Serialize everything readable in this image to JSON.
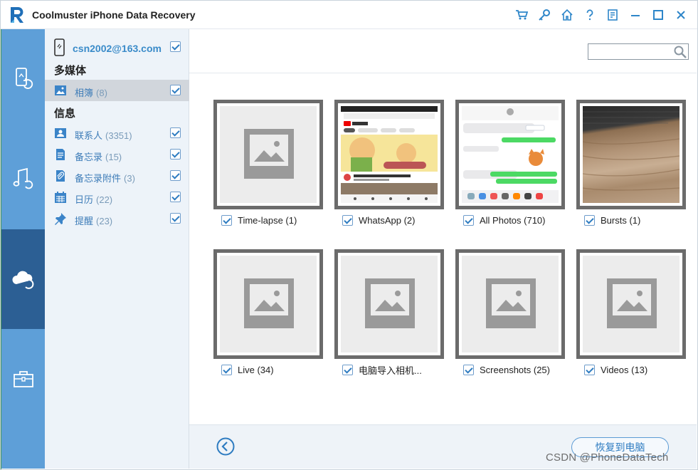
{
  "window": {
    "title": "Coolmuster iPhone Data Recovery",
    "toolbar_icons": [
      "cart-icon",
      "key-icon",
      "home-icon",
      "help-icon",
      "feedback-icon",
      "minimize-icon",
      "maximize-icon",
      "close-icon"
    ]
  },
  "rail": {
    "items": [
      {
        "name": "recover-from-device",
        "icon": "phone-refresh-icon"
      },
      {
        "name": "recover-from-itunes",
        "icon": "music-refresh-icon"
      },
      {
        "name": "recover-from-icloud",
        "icon": "cloud-refresh-icon",
        "active": true
      },
      {
        "name": "toolkit",
        "icon": "toolbox-icon"
      }
    ]
  },
  "categories": {
    "account": "csn2002@163.com",
    "sections": [
      {
        "title": "多媒体",
        "items": [
          {
            "label": "相簿",
            "count": "(8)",
            "icon": "photo-icon",
            "selected": true
          }
        ]
      },
      {
        "title": "信息",
        "items": [
          {
            "label": "联系人",
            "count": "(3351)",
            "icon": "contact-icon"
          },
          {
            "label": "备忘录",
            "count": "(15)",
            "icon": "note-icon"
          },
          {
            "label": "备忘录附件",
            "count": "(3)",
            "icon": "attachment-icon"
          },
          {
            "label": "日历",
            "count": "(22)",
            "icon": "calendar-icon"
          },
          {
            "label": "提醒",
            "count": "(23)",
            "icon": "pin-icon"
          }
        ]
      }
    ]
  },
  "search": {
    "value": "",
    "placeholder": ""
  },
  "albums": [
    {
      "label": "Time-lapse (1)",
      "thumb": "placeholder"
    },
    {
      "label": "WhatsApp (2)",
      "thumb": "youtube-screenshot"
    },
    {
      "label": "All Photos (710)",
      "thumb": "messages-screenshot"
    },
    {
      "label": "Bursts (1)",
      "thumb": "wood-photo"
    },
    {
      "label": "Live (34)",
      "thumb": "placeholder"
    },
    {
      "label": "电脑导入相机...",
      "thumb": "placeholder"
    },
    {
      "label": "Screenshots (25)",
      "thumb": "placeholder"
    },
    {
      "label": "Videos (13)",
      "thumb": "placeholder"
    }
  ],
  "footer": {
    "recover_label": "恢复到电脑",
    "watermark": "CSDN @PhoneDataTech"
  },
  "colors": {
    "rail": "#5e9fd8",
    "rail_active": "#2c5f94",
    "accent": "#2e7cc1",
    "panel": "#edf3f9"
  }
}
